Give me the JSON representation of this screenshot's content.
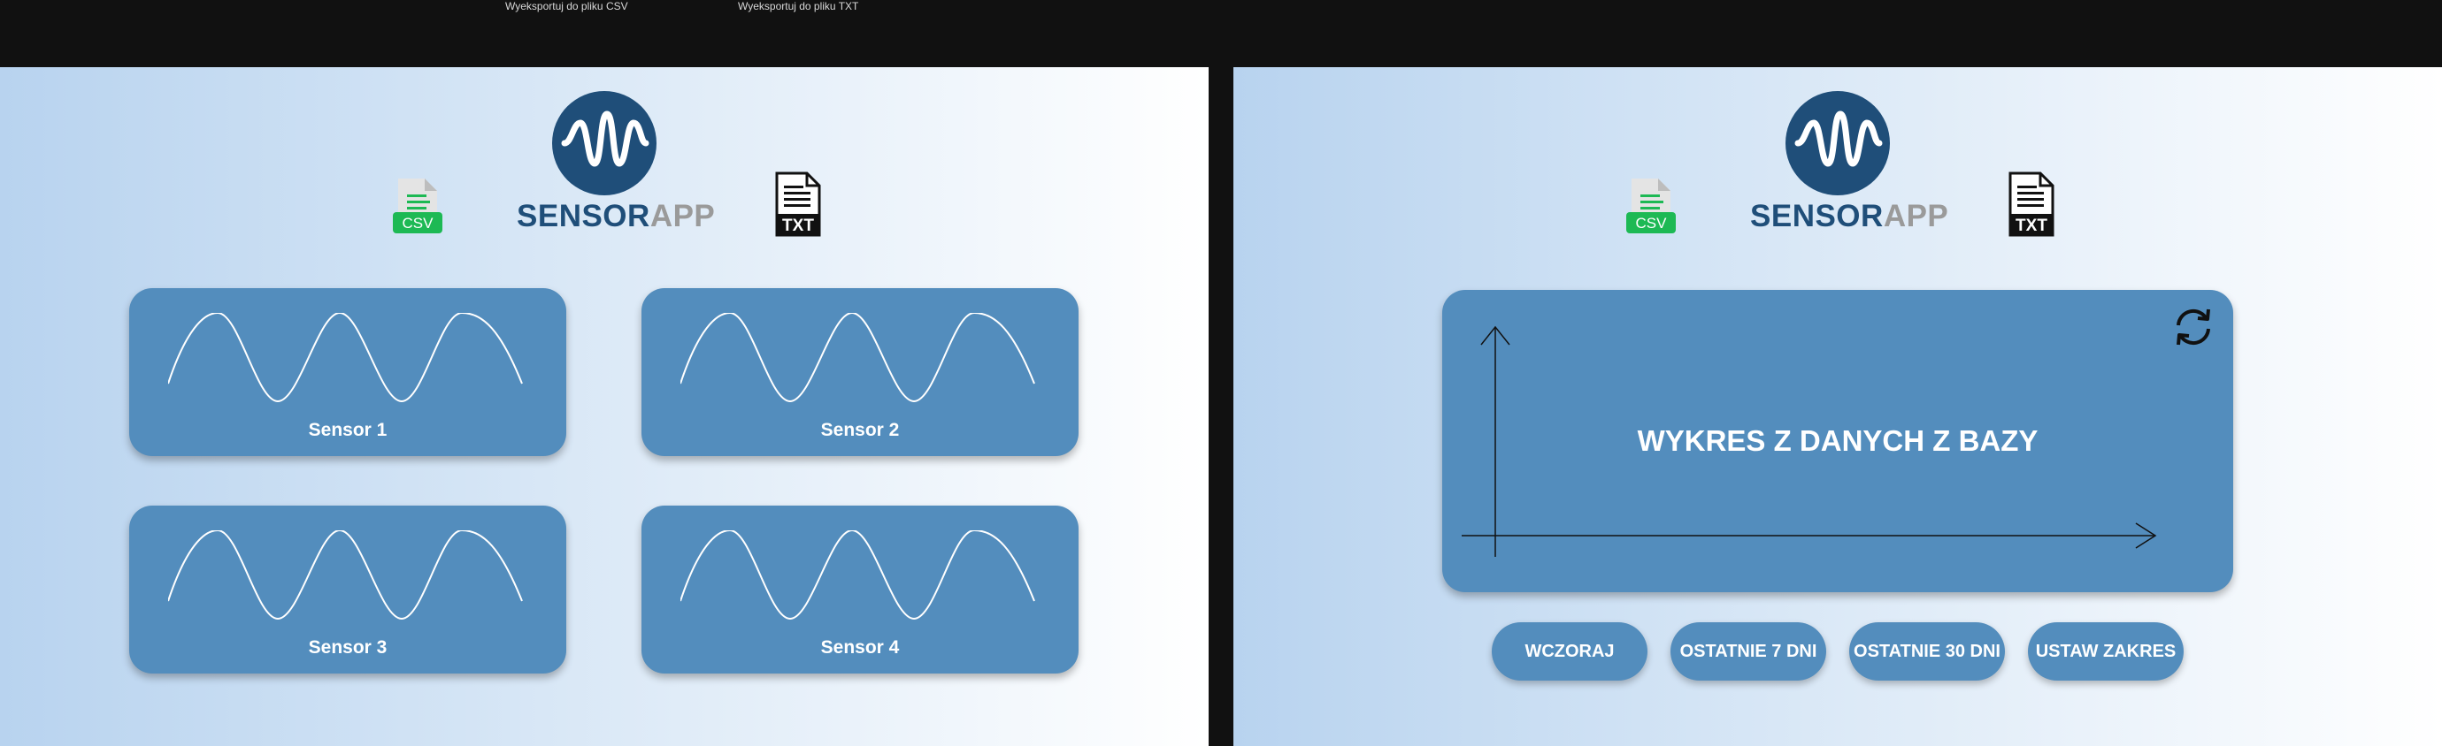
{
  "top_labels": {
    "export_csv": "Wyeksportuj do pliku CSV",
    "export_txt": "Wyeksportuj do pliku TXT"
  },
  "brand": {
    "name_primary": "SENSOR",
    "name_secondary": "APP",
    "primary_color": "#1f4e79",
    "secondary_color": "#9a9a9a"
  },
  "icons": {
    "csv_badge": "CSV",
    "txt_badge": "TXT",
    "logo": "waveform-icon",
    "refresh": "refresh-icon"
  },
  "sensors": [
    {
      "label": "Sensor 1"
    },
    {
      "label": "Sensor 2"
    },
    {
      "label": "Sensor 3"
    },
    {
      "label": "Sensor 4"
    }
  ],
  "chart_panel": {
    "title": "WYKRES Z DANYCH Z BAZY"
  },
  "range_buttons": [
    {
      "label": "WCZORAJ"
    },
    {
      "label": "OSTATNIE 7 DNI"
    },
    {
      "label": "OSTATNIE 30 DNI"
    },
    {
      "label": "USTAW ZAKRES"
    }
  ],
  "colors": {
    "card": "#538dbd",
    "csv_green": "#1db954",
    "background_dark": "#111111"
  }
}
